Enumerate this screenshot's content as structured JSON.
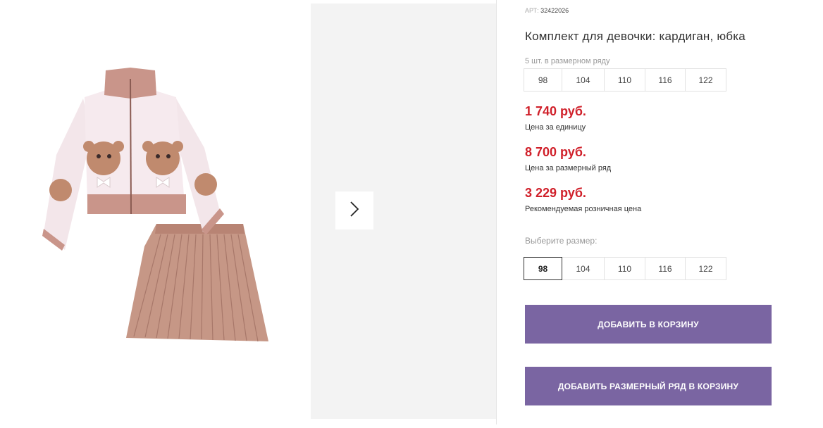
{
  "product": {
    "sku_label": "АРТ:",
    "sku_value": "32422026",
    "title": "Комплект для девочки: кардиган, юбка",
    "row_hint": "5 шт. в размерном ряду"
  },
  "size_row": [
    "98",
    "104",
    "110",
    "116",
    "122"
  ],
  "prices": [
    {
      "amount": "1 740 руб.",
      "label": "Цена за единицу"
    },
    {
      "amount": "8 700 руб.",
      "label": "Цена за размерный ряд"
    },
    {
      "amount": "3 229 руб.",
      "label": "Рекомендуемая розничная цена"
    }
  ],
  "size_select": {
    "label": "Выберите размер:",
    "options": [
      "98",
      "104",
      "110",
      "116",
      "122"
    ],
    "selected": "98"
  },
  "buttons": {
    "add_to_cart": "ДОБАВИТЬ В КОРЗИНУ",
    "add_row_to_cart": "ДОБАВИТЬ РАЗМЕРНЫЙ РЯД В КОРЗИНУ"
  },
  "icons": {
    "next": "chevron-right-icon"
  },
  "colors": {
    "price": "#d0202a",
    "button": "#7a65a2",
    "cardigan_body": "#f6eaee",
    "trim": "#c9958a",
    "skirt": "#c69786"
  }
}
